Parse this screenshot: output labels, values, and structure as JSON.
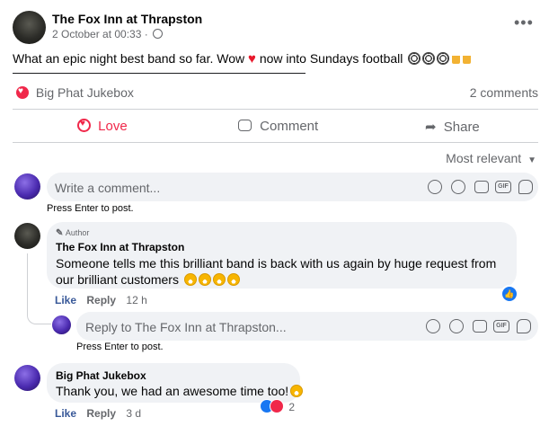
{
  "post": {
    "author": "The Fox Inn at Thrapston",
    "timestamp": "2 October at 00:33 ·",
    "text": "What an epic night  best band so far. Wow",
    "text_after_heart": "now into Sundays football",
    "emojis": [
      "soccer-ball",
      "soccer-ball",
      "soccer-ball",
      "beer",
      "beer"
    ]
  },
  "reactions_bar": {
    "reactor_name": "Big Phat Jukebox",
    "comments_count": "2 comments"
  },
  "actions": {
    "love": "Love",
    "comment": "Comment",
    "share": "Share"
  },
  "sort": {
    "label": "Most relevant"
  },
  "write_comment": {
    "placeholder": "Write a comment...",
    "hint": "Press Enter to post."
  },
  "comments": [
    {
      "badge": "Author",
      "author": "The Fox Inn at Thrapston",
      "text": "Someone tells me this brilliant band is back with us again by huge request from our brilliant customers",
      "like": "Like",
      "reply": "Reply",
      "time": "12 h"
    },
    {
      "author": "Big Phat Jukebox",
      "text": "Thank you, we had an awesome time too!",
      "like": "Like",
      "reply": "Reply",
      "time": "3 d",
      "reaction_count": "2"
    }
  ],
  "reply_box": {
    "placeholder": "Reply to The Fox Inn at Thrapston...",
    "hint": "Press Enter to post."
  },
  "colors": {
    "love_red": "#f0284a",
    "like_blue": "#1877f2",
    "bubble_bg": "#f0f2f5",
    "link_blue": "#385898"
  }
}
